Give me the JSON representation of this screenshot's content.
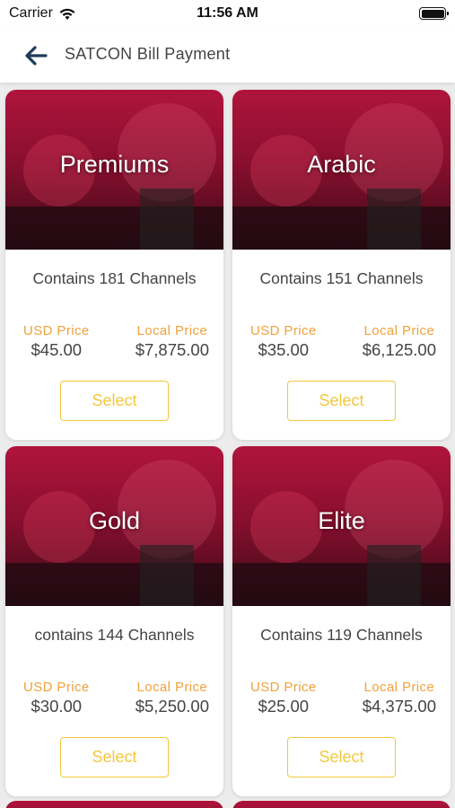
{
  "status_bar": {
    "carrier": "Carrier",
    "time": "11:56 AM",
    "icons": [
      "wifi-icon",
      "battery-icon"
    ],
    "battery_level": 1.0
  },
  "nav": {
    "title": "SATCON Bill Payment",
    "back_icon": "arrow-left-icon",
    "accent_color": "#1f3b57"
  },
  "colors": {
    "price_label": "#f0a13c",
    "select_border": "#f3c83c",
    "banner": "#b0143c"
  },
  "packages": [
    {
      "name": "Premiums",
      "channels": "Contains 181 Channels",
      "usd_label": "USD Price",
      "usd_price": "$45.00",
      "local_label": "Local Price",
      "local_price": "$7,875.00",
      "select_label": "Select"
    },
    {
      "name": "Arabic",
      "channels": "Contains 151 Channels",
      "usd_label": "USD Price",
      "usd_price": "$35.00",
      "local_label": "Local Price",
      "local_price": "$6,125.00",
      "select_label": "Select"
    },
    {
      "name": "Gold",
      "channels": "contains 144 Channels",
      "usd_label": "USD Price",
      "usd_price": "$30.00",
      "local_label": "Local Price",
      "local_price": "$5,250.00",
      "select_label": "Select"
    },
    {
      "name": "Elite",
      "channels": "Contains 119 Channels",
      "usd_label": "USD Price",
      "usd_price": "$25.00",
      "local_label": "Local Price",
      "local_price": "$4,375.00",
      "select_label": "Select"
    }
  ]
}
